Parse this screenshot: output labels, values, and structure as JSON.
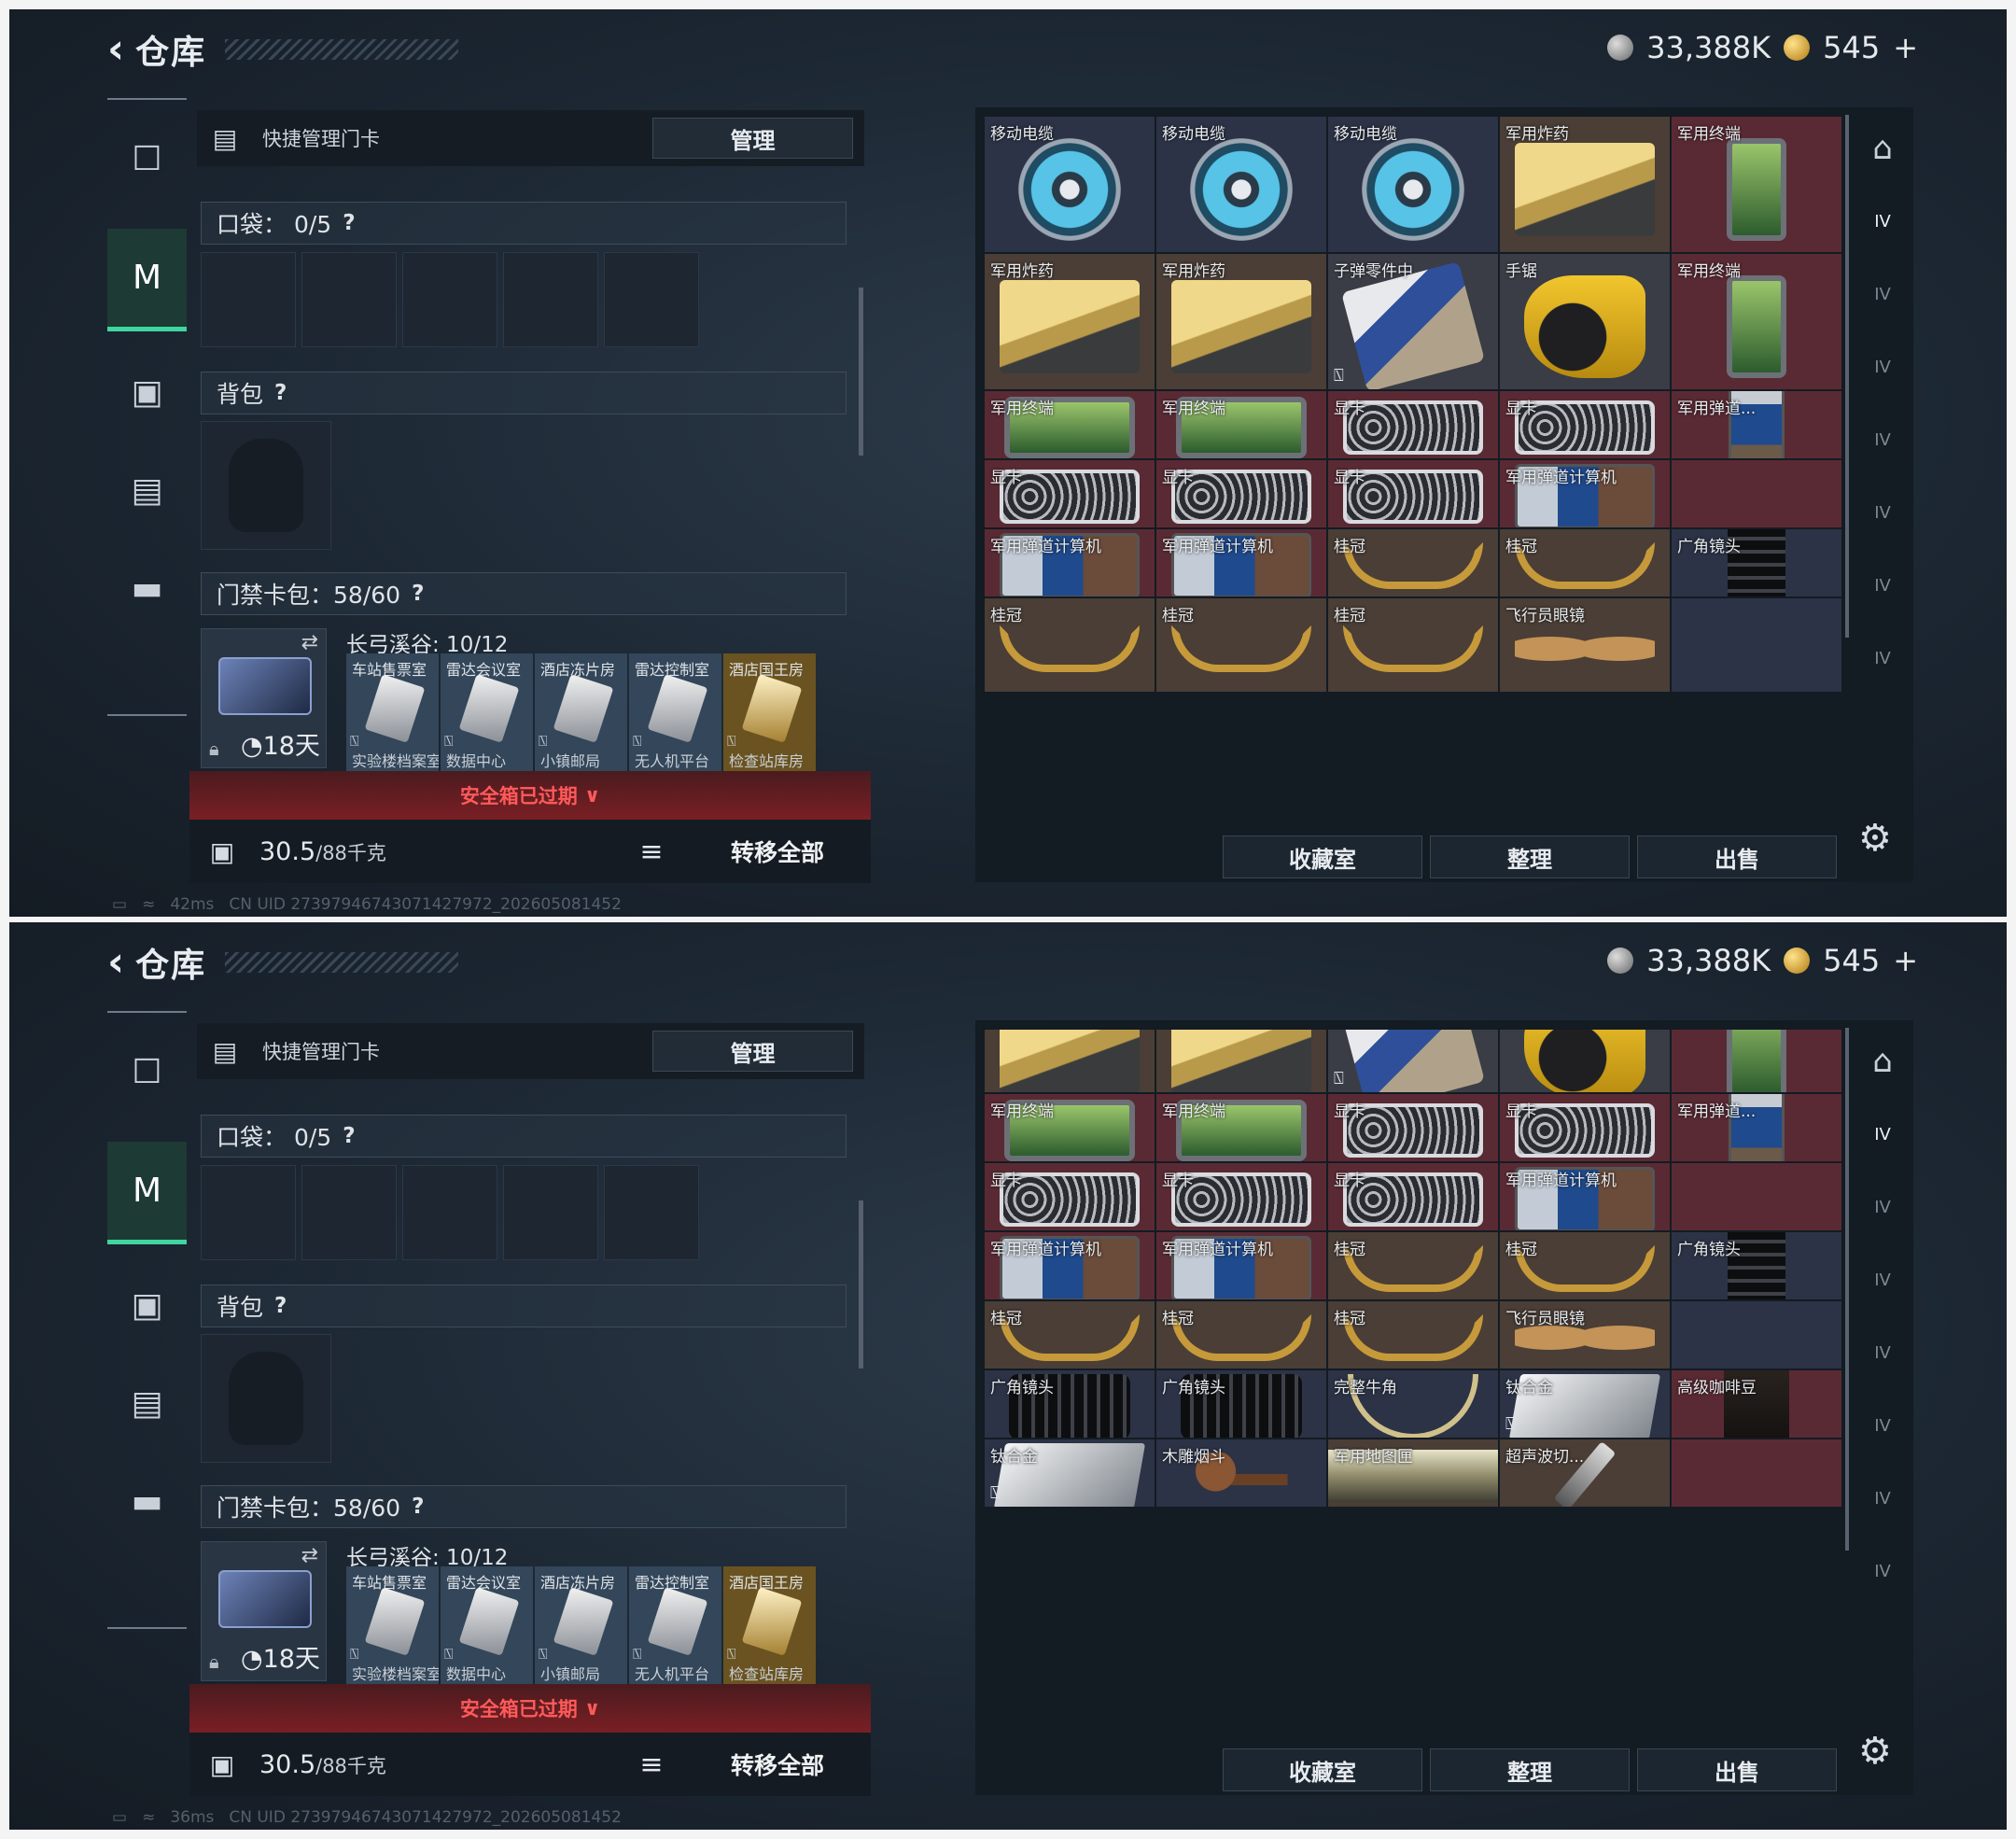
{
  "header": {
    "back_icon": "back-arrow-icon",
    "title": "仓库",
    "silver": "33,388K",
    "gold": "545",
    "gold_plus": "+"
  },
  "nav": [
    {
      "icon": "pistol-icon"
    },
    {
      "icon": "armor-vest-icon",
      "active": true
    },
    {
      "icon": "backpack-icon"
    },
    {
      "icon": "card-holder-icon"
    },
    {
      "icon": "briefcase-icon"
    }
  ],
  "left": {
    "quick_manage": "快捷管理门卡",
    "manage_button": "管理",
    "pocket_label": "口袋：",
    "pocket_value": "0/5",
    "help": "?",
    "backpack_label": "背包",
    "cardpack_label": "门禁卡包：",
    "cardpack_value": "58/60",
    "card_holder_days": "18天",
    "card_map": "长弓溪谷: 10/12",
    "cards": [
      {
        "name": "车站售票室",
        "name2": "实验楼档案室"
      },
      {
        "name": "雷达会议室",
        "name2": "数据中心"
      },
      {
        "name": "酒店冻片房",
        "name2": "小镇邮局"
      },
      {
        "name": "雷达控制室",
        "name2": "无人机平台"
      },
      {
        "name": "酒店国王房",
        "name2": "检查站库房",
        "gold": true
      }
    ],
    "expired": "安全箱已过期",
    "weight": "30.5",
    "weight_max": "/88千克",
    "transfer_all": "转移全部"
  },
  "status": {
    "ms1": "42ms",
    "ms2": "36ms",
    "uid": "CN UID 2739794674307142797​2_202605081452"
  },
  "right": {
    "actions": [
      "收藏室",
      "整理",
      "出售"
    ],
    "side_icons": [
      "vault-icon",
      "iv-item-icon",
      "iv-item-icon",
      "iv-item-icon",
      "iv-item-icon",
      "iv-item-icon",
      "iv-item-icon",
      "iv-item-icon"
    ]
  },
  "grid1": [
    {
      "n": "移动电缆",
      "t": "reel",
      "c": "b"
    },
    {
      "n": "移动电缆",
      "t": "reel",
      "c": "b"
    },
    {
      "n": "移动电缆",
      "t": "reel",
      "c": "b"
    },
    {
      "n": "军用炸药",
      "t": "box",
      "c": ""
    },
    {
      "n": "军用终端",
      "t": "term",
      "c": "r"
    },
    {
      "n": "军用炸药",
      "t": "box",
      "c": ""
    },
    {
      "n": "军用炸药",
      "t": "box",
      "c": ""
    },
    {
      "n": "子弹零件中",
      "t": "parts",
      "c": "g",
      "lk": true
    },
    {
      "n": "手锯",
      "t": "saw",
      "c": "g"
    },
    {
      "n": "军用终端",
      "t": "term",
      "c": "r"
    },
    {
      "n": "军用终端",
      "t": "term w",
      "c": "r"
    },
    {
      "n": "军用终端",
      "t": "term w",
      "c": "r"
    },
    {
      "n": "显卡",
      "t": "gpu",
      "c": "r"
    },
    {
      "n": "显卡",
      "t": "gpu",
      "c": "r"
    },
    {
      "n": "军用弹道...",
      "t": "calc v",
      "c": "r"
    },
    {
      "n": "显卡",
      "t": "gpu",
      "c": "r"
    },
    {
      "n": "显卡",
      "t": "gpu",
      "c": "r"
    },
    {
      "n": "显卡",
      "t": "gpu",
      "c": "r"
    },
    {
      "n": "军用弹道计算机",
      "t": "calc",
      "c": "r"
    },
    {
      "n": "",
      "t": "",
      "c": "r"
    },
    {
      "n": "军用弹道计算机",
      "t": "calc",
      "c": "r"
    },
    {
      "n": "军用弹道计算机",
      "t": "calc",
      "c": "r"
    },
    {
      "n": "桂冠",
      "t": "crown",
      "c": ""
    },
    {
      "n": "桂冠",
      "t": "crown",
      "c": ""
    },
    {
      "n": "广角镜头",
      "t": "lens",
      "c": "b"
    },
    {
      "n": "桂冠",
      "t": "crown",
      "c": ""
    },
    {
      "n": "桂冠",
      "t": "crown",
      "c": ""
    },
    {
      "n": "桂冠",
      "t": "crown",
      "c": ""
    },
    {
      "n": "飞行员眼镜",
      "t": "glass",
      "c": ""
    },
    {
      "n": "",
      "t": "",
      "c": "b"
    }
  ],
  "grid2": [
    {
      "n": "",
      "t": "box",
      "c": ""
    },
    {
      "n": "",
      "t": "box",
      "c": ""
    },
    {
      "n": "",
      "t": "parts",
      "c": "g",
      "lk": true
    },
    {
      "n": "",
      "t": "saw",
      "c": "g"
    },
    {
      "n": "",
      "t": "term",
      "c": "r"
    },
    {
      "n": "军用终端",
      "t": "term w",
      "c": "r"
    },
    {
      "n": "军用终端",
      "t": "term w",
      "c": "r"
    },
    {
      "n": "显卡",
      "t": "gpu",
      "c": "r"
    },
    {
      "n": "显卡",
      "t": "gpu",
      "c": "r"
    },
    {
      "n": "军用弹道...",
      "t": "calc v",
      "c": "r"
    },
    {
      "n": "显卡",
      "t": "gpu",
      "c": "r"
    },
    {
      "n": "显卡",
      "t": "gpu",
      "c": "r"
    },
    {
      "n": "显卡",
      "t": "gpu",
      "c": "r"
    },
    {
      "n": "军用弹道计算机",
      "t": "calc",
      "c": "r"
    },
    {
      "n": "",
      "t": "",
      "c": "r"
    },
    {
      "n": "军用弹道计算机",
      "t": "calc",
      "c": "r"
    },
    {
      "n": "军用弹道计算机",
      "t": "calc",
      "c": "r"
    },
    {
      "n": "桂冠",
      "t": "crown",
      "c": ""
    },
    {
      "n": "桂冠",
      "t": "crown",
      "c": ""
    },
    {
      "n": "广角镜头",
      "t": "lens",
      "c": "b"
    },
    {
      "n": "桂冠",
      "t": "crown",
      "c": ""
    },
    {
      "n": "桂冠",
      "t": "crown",
      "c": ""
    },
    {
      "n": "桂冠",
      "t": "crown",
      "c": ""
    },
    {
      "n": "飞行员眼镜",
      "t": "glass",
      "c": ""
    },
    {
      "n": "",
      "t": "",
      "c": "b"
    },
    {
      "n": "广角镜头",
      "t": "lens h",
      "c": "b"
    },
    {
      "n": "广角镜头",
      "t": "lens h",
      "c": "b"
    },
    {
      "n": "完整牛角",
      "t": "horn",
      "c": "b"
    },
    {
      "n": "钛合金",
      "t": "ti",
      "c": "b",
      "lk": true
    },
    {
      "n": "高级咖啡豆",
      "t": "coffee",
      "c": "r"
    },
    {
      "n": "钛合金",
      "t": "ti",
      "c": "b",
      "lk": true
    },
    {
      "n": "木雕烟斗",
      "t": "pipe",
      "c": "b"
    },
    {
      "n": "军用地图匣",
      "t": "tube",
      "c": "",
      "wide": true
    },
    {
      "n": "超声波切...",
      "t": "knife",
      "c": ""
    },
    {
      "n": "",
      "t": "",
      "c": "r"
    }
  ]
}
